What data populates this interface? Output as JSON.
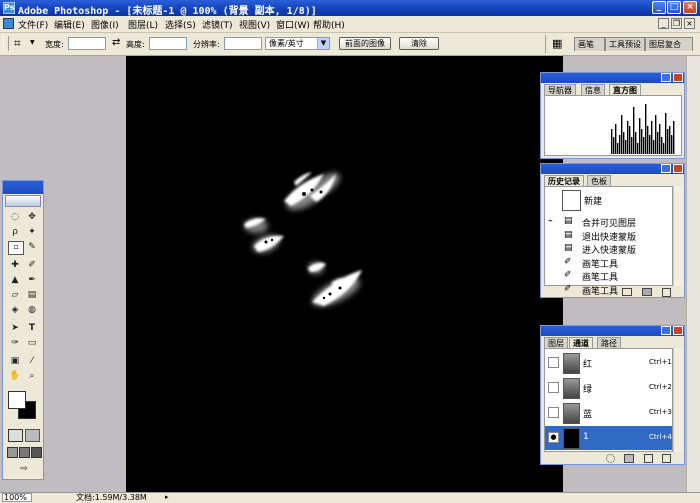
{
  "window": {
    "title": "Adobe Photoshop - [未标题-1 @ 100% (背景 副本, 1/8)]"
  },
  "menu": [
    "文件(F)",
    "编辑(E)",
    "图像(I)",
    "图层(L)",
    "选择(S)",
    "滤镜(T)",
    "视图(V)",
    "窗口(W)",
    "帮助(H)"
  ],
  "options": {
    "width_label": "宽度:",
    "height_label": "高度:",
    "resolution_label": "分辨率:",
    "unit_select": "像素/英寸",
    "front_image_button": "前面的图像",
    "clear_button": "清除"
  },
  "palette_well_tabs": [
    "画笔",
    "工具预设",
    "图层复合"
  ],
  "navigator_panel": {
    "tabs": [
      "导航器",
      "信息",
      "直方图"
    ],
    "active": "直方图",
    "histogram_heights": [
      0.45,
      0.3,
      0.55,
      0.2,
      0.35,
      0.7,
      0.4,
      0.25,
      0.6,
      0.5,
      0.3,
      0.85,
      0.4,
      0.2,
      0.65,
      0.45,
      0.3,
      0.9,
      0.5,
      0.35,
      0.6,
      0.25,
      0.7,
      0.4,
      0.55,
      0.3,
      0.2,
      0.75,
      0.45,
      0.5,
      0.35,
      0.6
    ]
  },
  "history_panel": {
    "tabs": [
      "历史记录",
      "色板"
    ],
    "snapshot_label": "新建",
    "items": [
      "合并可见图层",
      "退出快速蒙版",
      "进入快速蒙版",
      "画笔工具",
      "画笔工具",
      "画笔工具"
    ]
  },
  "channels_panel": {
    "tabs": [
      "图层",
      "通道",
      "路径"
    ],
    "channels": [
      {
        "name": "红",
        "shortcut": "Ctrl+1"
      },
      {
        "name": "绿",
        "shortcut": "Ctrl+2"
      },
      {
        "name": "蓝",
        "shortcut": "Ctrl+3"
      },
      {
        "name": "1",
        "shortcut": "Ctrl+4"
      }
    ]
  },
  "statusbar": {
    "zoom": "100%",
    "doc_info": "文档:1.59M/3.38M"
  },
  "colors": {
    "title_bar": "#1c4ac0",
    "selected_row": "#316ac5",
    "canvas": "#000000"
  }
}
